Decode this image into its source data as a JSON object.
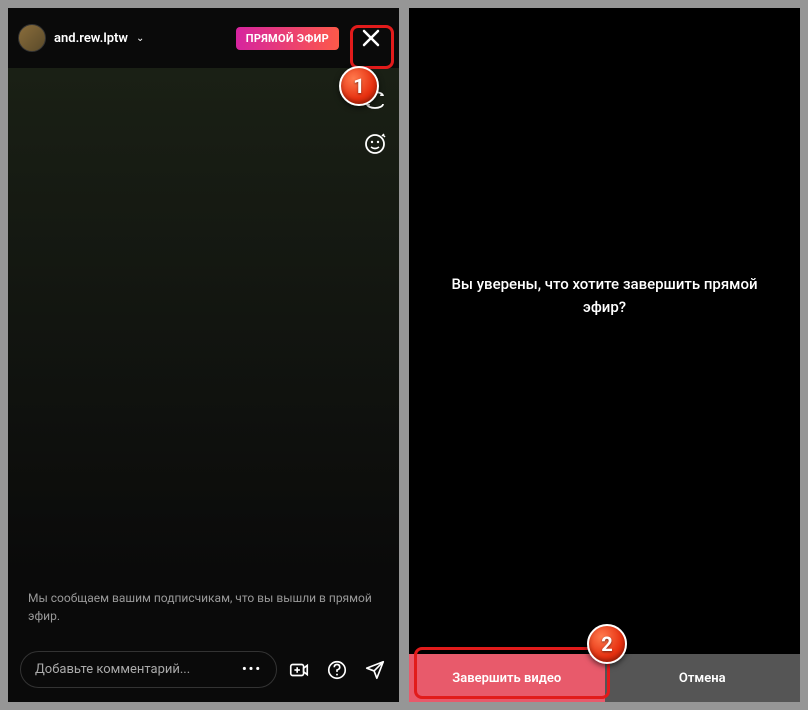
{
  "left": {
    "username": "and.rew.lptw",
    "liveBadge": "ПРЯМОЙ ЭФИР",
    "statusText": "Мы сообщаем вашим подписчикам, что вы вышли в прямой эфир.",
    "commentPlaceholder": "Добавьте комментарий..."
  },
  "right": {
    "confirmText": "Вы уверены, что хотите завершить прямой эфир?",
    "endButton": "Завершить видео",
    "cancelButton": "Отмена"
  },
  "annotations": {
    "step1": "1",
    "step2": "2"
  },
  "icons": {
    "close": "close-icon",
    "switchCamera": "switch-camera-icon",
    "faceFilter": "face-filter-icon",
    "addVideo": "add-video-icon",
    "question": "question-icon",
    "send": "send-icon"
  }
}
